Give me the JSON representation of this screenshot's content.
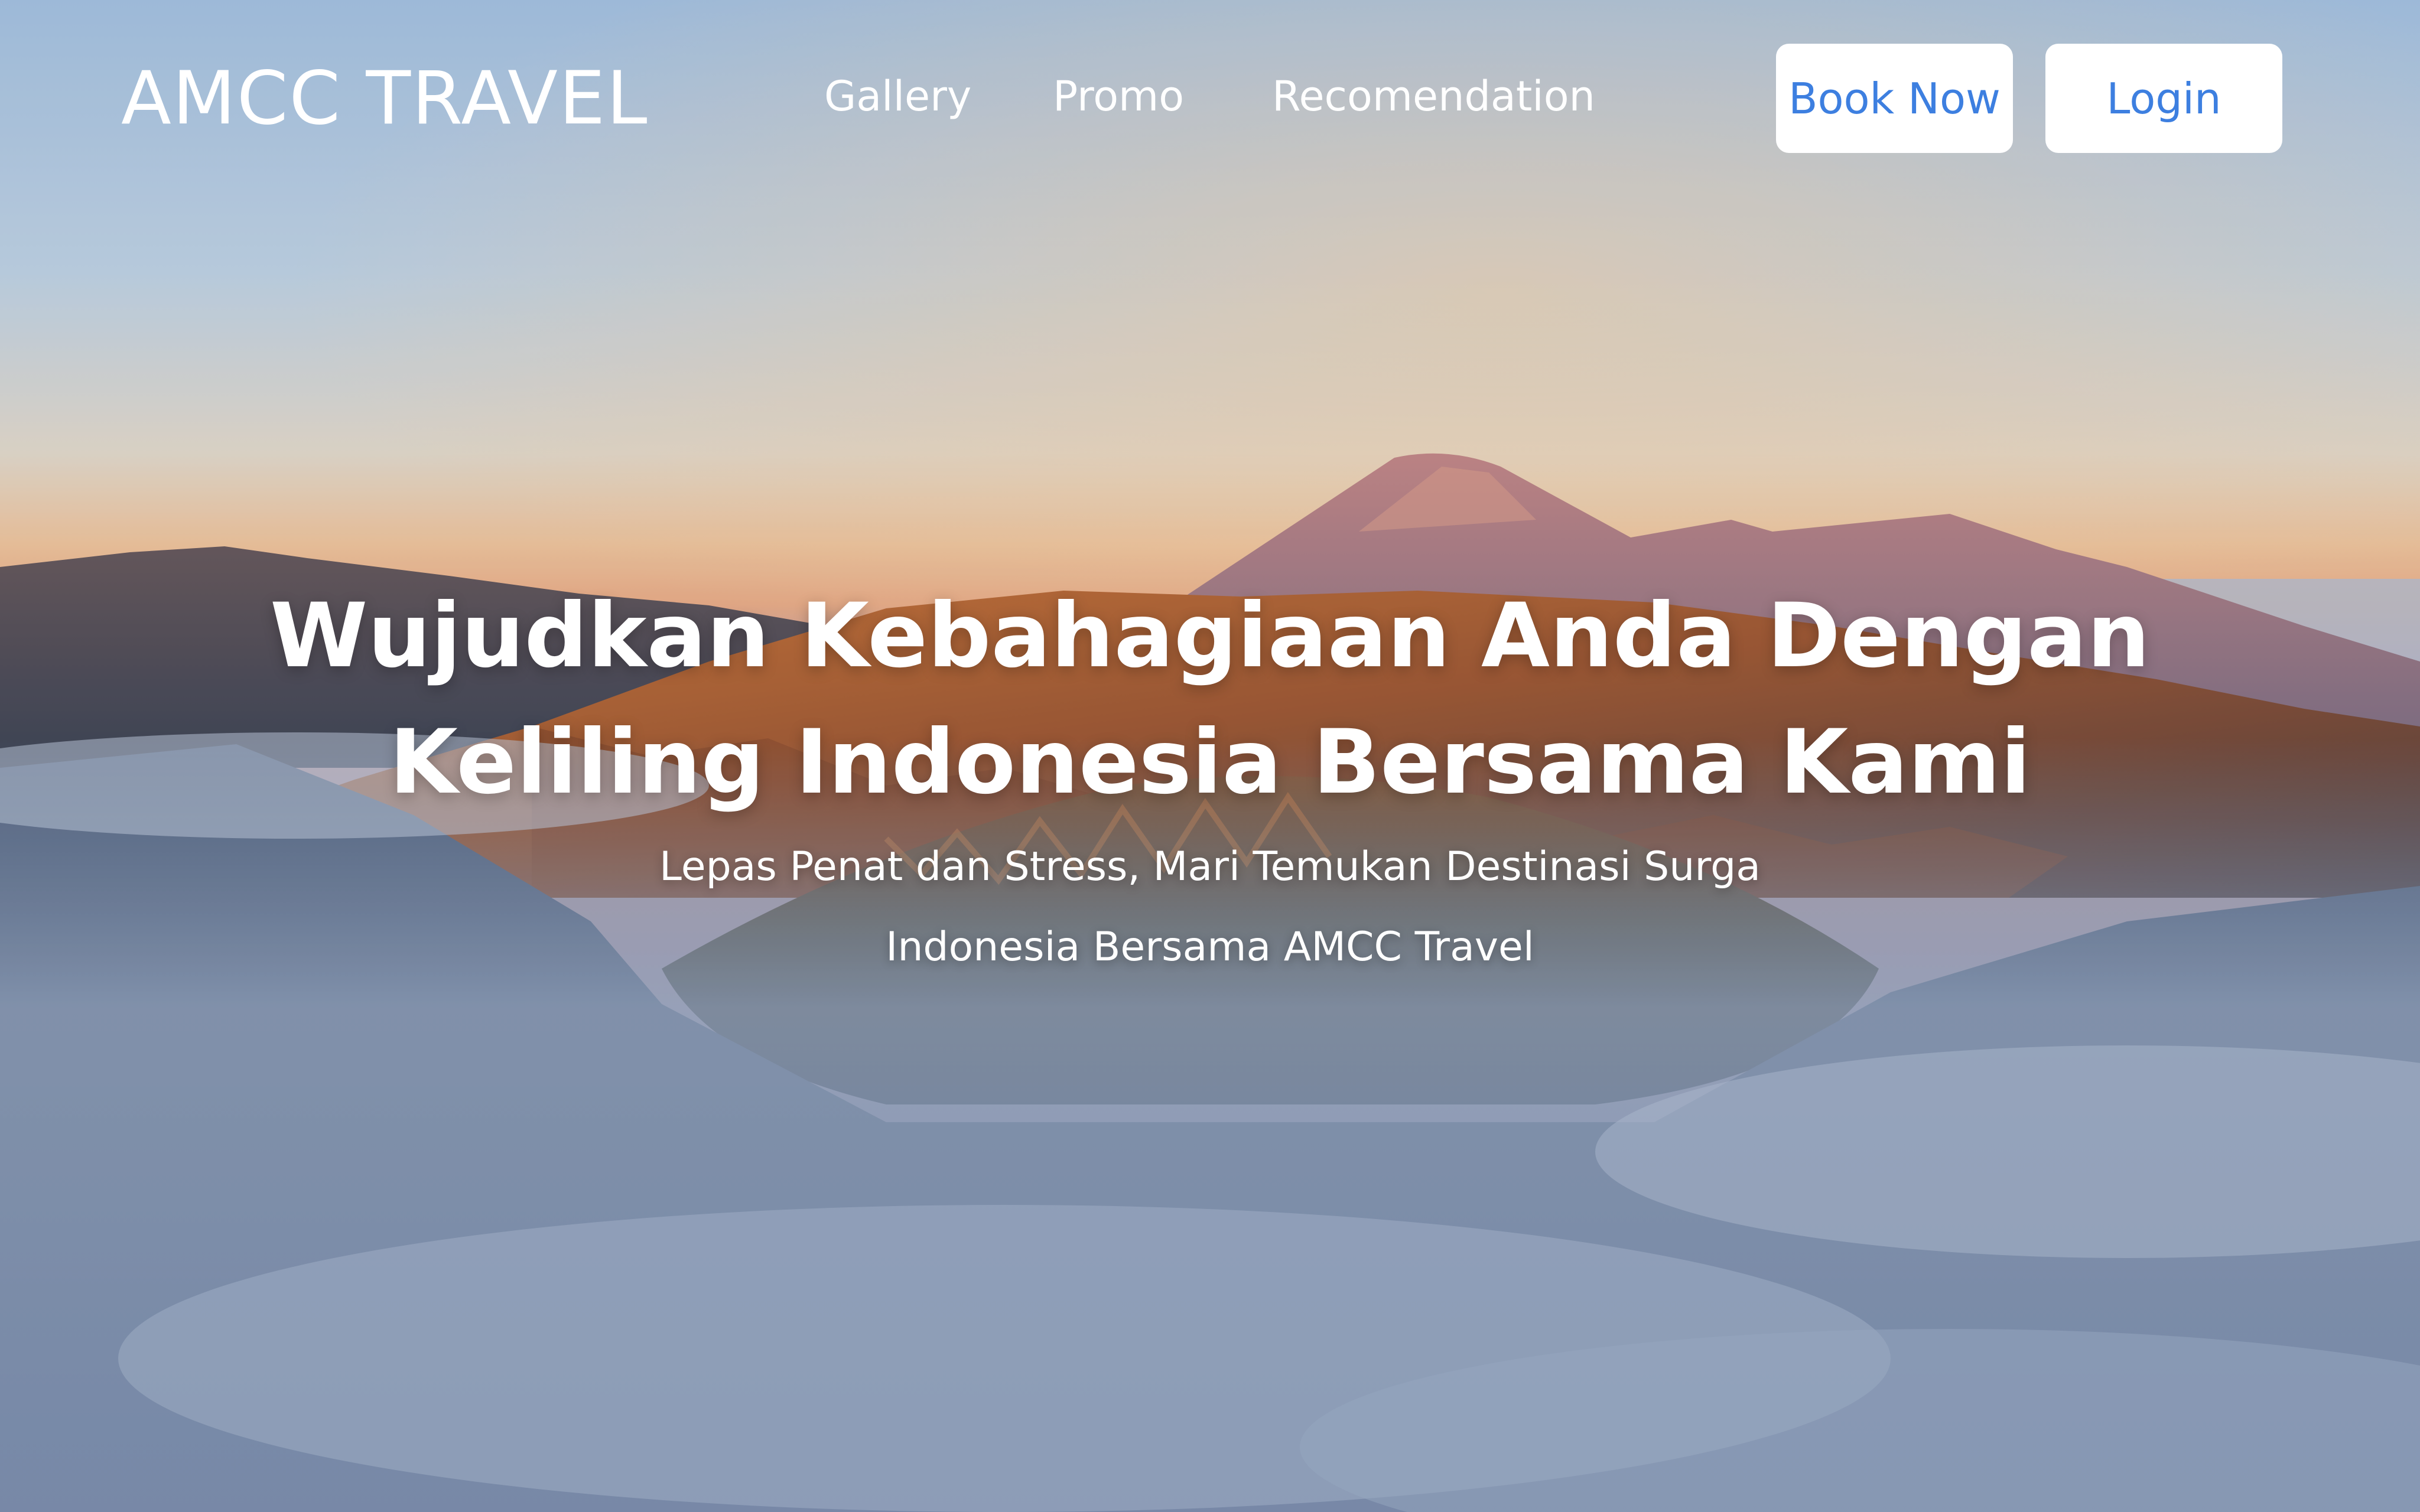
{
  "brand": {
    "name": "AMCC TRAVEL"
  },
  "nav": {
    "links": [
      {
        "label": "Gallery"
      },
      {
        "label": "Promo"
      },
      {
        "label": "Recomendation"
      }
    ],
    "book_button": "Book Now",
    "login_button": "Login"
  },
  "hero": {
    "headline_line1": "Wujudkan Kebahagiaan Anda Dengan",
    "headline_line2": "Keliling Indonesia Bersama Kami",
    "subtitle_line1": "Lepas Penat dan Stress, Mari Temukan Destinasi Surga",
    "subtitle_line2": "Indonesia Bersama AMCC Travel"
  },
  "colors": {
    "accent": "#3d7fe0",
    "text_on_image": "#ffffff",
    "button_bg": "#ffffff"
  }
}
